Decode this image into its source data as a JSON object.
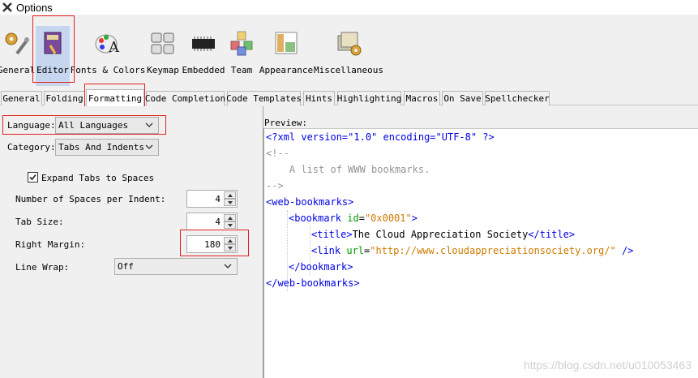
{
  "window": {
    "title": "Options"
  },
  "categories": [
    {
      "label": "General"
    },
    {
      "label": "Editor"
    },
    {
      "label": "Fonts & Colors"
    },
    {
      "label": "Keymap"
    },
    {
      "label": "Embedded"
    },
    {
      "label": "Team"
    },
    {
      "label": "Appearance"
    },
    {
      "label": "Miscellaneous"
    }
  ],
  "tabs": [
    {
      "label": "General"
    },
    {
      "label": "Folding"
    },
    {
      "label": "Formatting"
    },
    {
      "label": "Code Completion"
    },
    {
      "label": "Code Templates"
    },
    {
      "label": "Hints"
    },
    {
      "label": "Highlighting"
    },
    {
      "label": "Macros"
    },
    {
      "label": "On Save"
    },
    {
      "label": "Spellchecker"
    }
  ],
  "form": {
    "language_label": "Language:",
    "language_value": "All Languages",
    "category_label": "Category:",
    "category_value": "Tabs And Indents",
    "expand_tabs_label": "Expand Tabs to Spaces",
    "expand_tabs_checked": true,
    "spaces_per_indent_label": "Number of Spaces per Indent:",
    "spaces_per_indent_value": "4",
    "tab_size_label": "Tab Size:",
    "tab_size_value": "4",
    "right_margin_label": "Right Margin:",
    "right_margin_value": "180",
    "line_wrap_label": "Line Wrap:",
    "line_wrap_value": "Off"
  },
  "preview": {
    "label": "Preview:",
    "l1": "<?xml version=\"1.0\" encoding=\"UTF-8\" ?>",
    "l2": "<!--",
    "l3": "    A list of WWW bookmarks.",
    "l4": "-->",
    "l5": "<web-bookmarks>",
    "l6_open": "<bookmark ",
    "l6_attr": "id",
    "l6_eq": "=",
    "l6_val": "\"0x0001\"",
    "l6_close": ">",
    "l7_open": "<title>",
    "l7_text": "The Cloud Appreciation Society",
    "l7_close": "</title>",
    "l8_open": "<link ",
    "l8_attr": "url",
    "l8_eq": "=",
    "l8_val": "\"http://www.cloudappreciationsociety.org/\"",
    "l8_close": " />",
    "l9": "</bookmark>",
    "l10": "</web-bookmarks>"
  },
  "watermark": "https://blog.csdn.net/u010053463",
  "icons": {
    "app": "netbeans-icon",
    "general": "gears-wrench-icon",
    "editor": "book-pen-icon",
    "fonts": "palette-font-icon",
    "keymap": "keyboard-icon",
    "embedded": "chip-icon",
    "team": "cubes-icon",
    "appearance": "window-layout-icon",
    "misc": "photos-gear-icon"
  },
  "colors": {
    "tag": "#0000e6",
    "attr": "#009900",
    "value": "#ce7b00",
    "comment": "#969696",
    "highlight_box": "#e02020",
    "selected_category": "#c6d6ef"
  }
}
